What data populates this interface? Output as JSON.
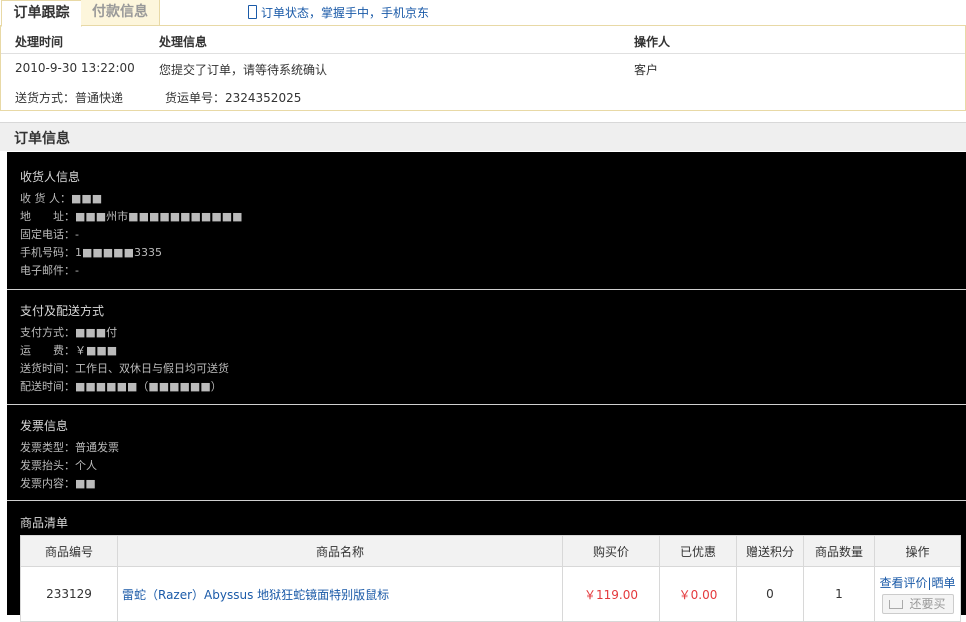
{
  "tabs": [
    {
      "label": "订单跟踪"
    },
    {
      "label": "付款信息"
    }
  ],
  "top_link": "订单状态，掌握手中，手机京东",
  "tracking": {
    "headers": {
      "time": "处理时间",
      "info": "处理信息",
      "operator": "操作人"
    },
    "row": {
      "time": "2010-9-30 13:22:00",
      "info": "您提交了订单，请等待系统确认",
      "operator": "客户"
    },
    "shipping_method": "送货方式：普通快递",
    "tracking_no": "货运单号：2324352025"
  },
  "order_info_title": "订单信息",
  "sections": {
    "receiver": {
      "title": "收货人信息",
      "lines": [
        "收 货 人：■■■",
        "地　　址：■■■州市■■■■■■■■■■■",
        "固定电话：-",
        "手机号码：1■■■■■3335",
        "电子邮件：-"
      ]
    },
    "payment": {
      "title": "支付及配送方式",
      "lines": [
        "支付方式：■■■付",
        "运　　费：￥■■■",
        "送货时间：工作日、双休日与假日均可送货",
        "配送时间：■■■■■■（■■■■■■）"
      ]
    },
    "invoice": {
      "title": "发票信息",
      "lines": [
        "发票类型：普通发票",
        "发票抬头：个人",
        "发票内容：■■"
      ]
    },
    "goods_title": "商品清单"
  },
  "goods_table": {
    "headers": [
      "商品编号",
      "商品名称",
      "购买价",
      "已优惠",
      "赠送积分",
      "商品数量",
      "操作"
    ],
    "rows": [
      {
        "id": "233129",
        "name": "雷蛇（Razer）Abyssus 地狱狂蛇镜面特别版鼠标",
        "price": "￥119.00",
        "discount": "￥0.00",
        "points": "0",
        "qty": "1",
        "review": "查看评价",
        "share": "|晒单",
        "buy_again": "还要买"
      }
    ]
  }
}
